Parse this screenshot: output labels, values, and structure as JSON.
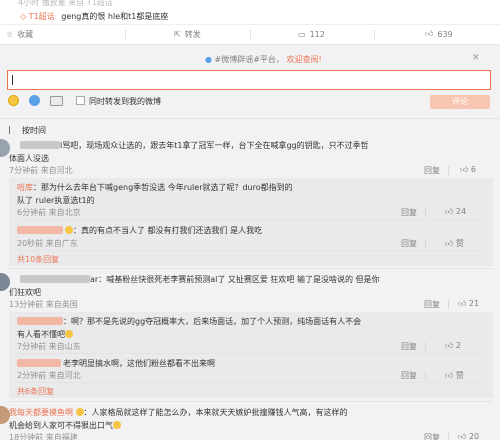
{
  "header": {
    "meta": "4小时 播放量 来自 T1超话",
    "topic_tag": "T1超话",
    "topic_text": "geng真的恨 hle和t1都是底座"
  },
  "actions": {
    "favorite": "收藏",
    "repost": "转发",
    "comment_count": "112",
    "like_count": "639"
  },
  "comment_panel": {
    "notice_text": "#微博辟谣#平台，",
    "notice_link": "欢迎查阅!",
    "repost_label": "同时转发到我的微博",
    "submit_label": "评论",
    "sort_label": "按时间"
  },
  "comments": [
    {
      "text_line1": "l骂吧，现场观众让选的，跟去年t1拿了冠军一样，台下全在喊拿gg的钥匙，只不过季哲",
      "text_line2": "体面人没选",
      "time": "7分钟前 来自河北",
      "reply": "回复",
      "likes": "6",
      "replies": [
        {
          "name": "哈库",
          "text_line1": "：那为什么去年台下喊geng季哲没选 今年ruler就选了呢？duro都指到的",
          "text_line2": "队了 ruler执意选t1的",
          "time": "6分钟前 来自北京",
          "reply": "回复",
          "likes": "24"
        },
        {
          "name": "",
          "text_line1": "：真的有点不当人了 都没有打我们还选我们 是人我吃",
          "text_line2": "",
          "time": "20秒前 来自广东",
          "reply": "回复",
          "likes": "赞"
        }
      ],
      "more": "共10条回复"
    },
    {
      "text_line1": "ar：喊基粉丝快很死老李赛前预测al了 又扯赛区爱 狂欢吧 输了是没啥说的 但是你",
      "text_line2": "们狂欢吧",
      "time": "13分钟前 来自英国",
      "reply": "回复",
      "likes": "21",
      "replies": [
        {
          "name": "",
          "text_line1": "：啊？那不是先说的gg夺冠概率大，后来场面话，加了个人预测，纯场面话有人不会",
          "text_line2": "有人看不懂吧",
          "time": "7分钟前 来自山东",
          "reply": "回复",
          "likes": "2"
        },
        {
          "name": "",
          "text_line1": "老李明显搞水啊，这他们粉丝都看不出来啊",
          "text_line2": "",
          "time": "2分钟前 来自河北",
          "reply": "回复",
          "likes": "赞"
        }
      ],
      "more": "共6条回复"
    },
    {
      "name": "我每天都要摸鱼啊",
      "text_line1": "：人家格局就这样了能怎么办，本来就天天嫉妒批撞赚钱人气高，有这样的",
      "text_line2": "机会给到人家可不得狠出口气",
      "time": "18分钟前 来自福建",
      "reply": "回复",
      "likes": "20"
    }
  ],
  "colors": {
    "accent": "#eb7350",
    "panel_bg": "#f2f2f5",
    "reply_bg": "#eaeaec"
  },
  "icons": [
    "star-icon",
    "repost-icon",
    "comment-icon",
    "thumb-up-icon",
    "emoji-icon",
    "at-user-icon",
    "image-icon",
    "close-icon"
  ]
}
